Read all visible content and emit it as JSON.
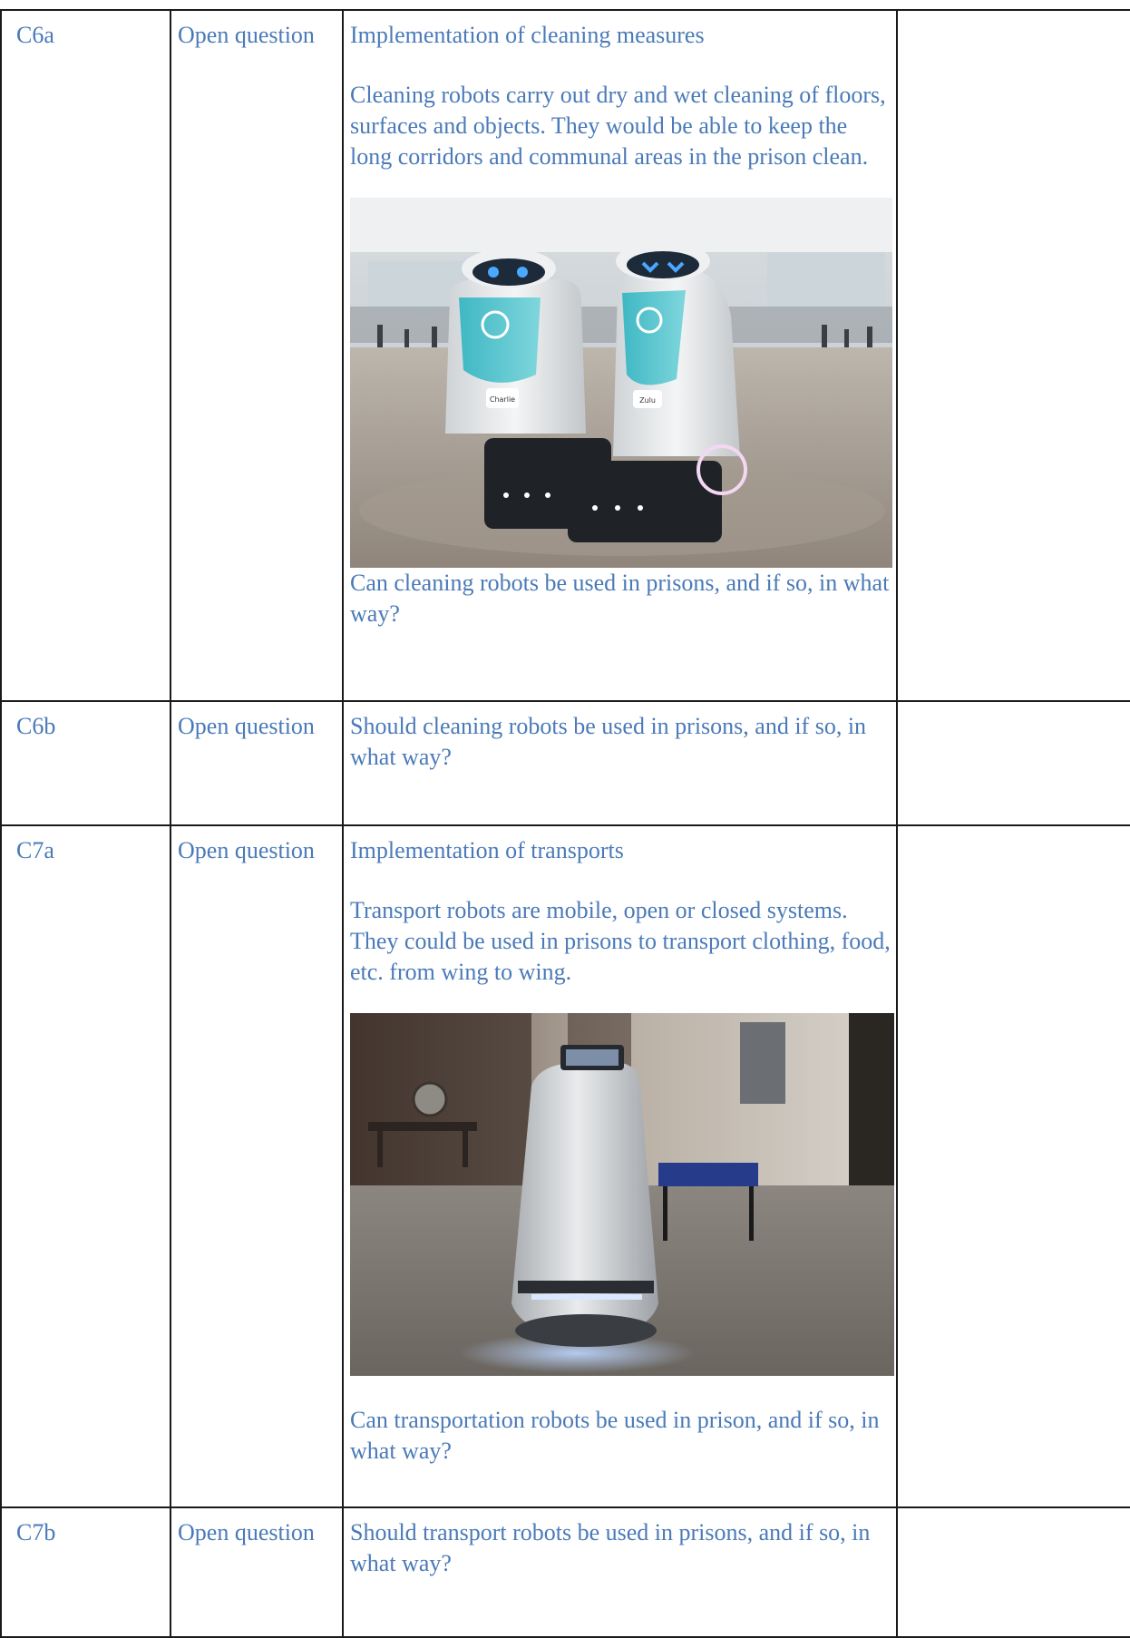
{
  "rows": [
    {
      "code": "C6a",
      "type": "Open question",
      "heading": "Implementation of cleaning measures",
      "description": "Cleaning robots carry out dry and wet cleaning of floors, surfaces and objects. They would be able to keep the long corridors and communal areas in the prison clean.",
      "image_label_1": "Charlie",
      "image_label_2": "Zulu",
      "question": "Can cleaning robots be used in prisons, and if so, in what way?"
    },
    {
      "code": "C6b",
      "type": "Open question",
      "question": "Should cleaning robots be used in prisons, and if so, in what way?"
    },
    {
      "code": "C7a",
      "type": "Open question",
      "heading": "Implementation of transports",
      "description": "Transport robots are mobile, open or closed systems. They could be used in prisons to transport clothing, food, etc. from wing to wing.",
      "question": "Can transportation robots be used in prison, and if so, in what way?"
    },
    {
      "code": "C7b",
      "type": "Open question",
      "question": "Should transport robots be used in prisons, and if so, in what way?"
    }
  ]
}
